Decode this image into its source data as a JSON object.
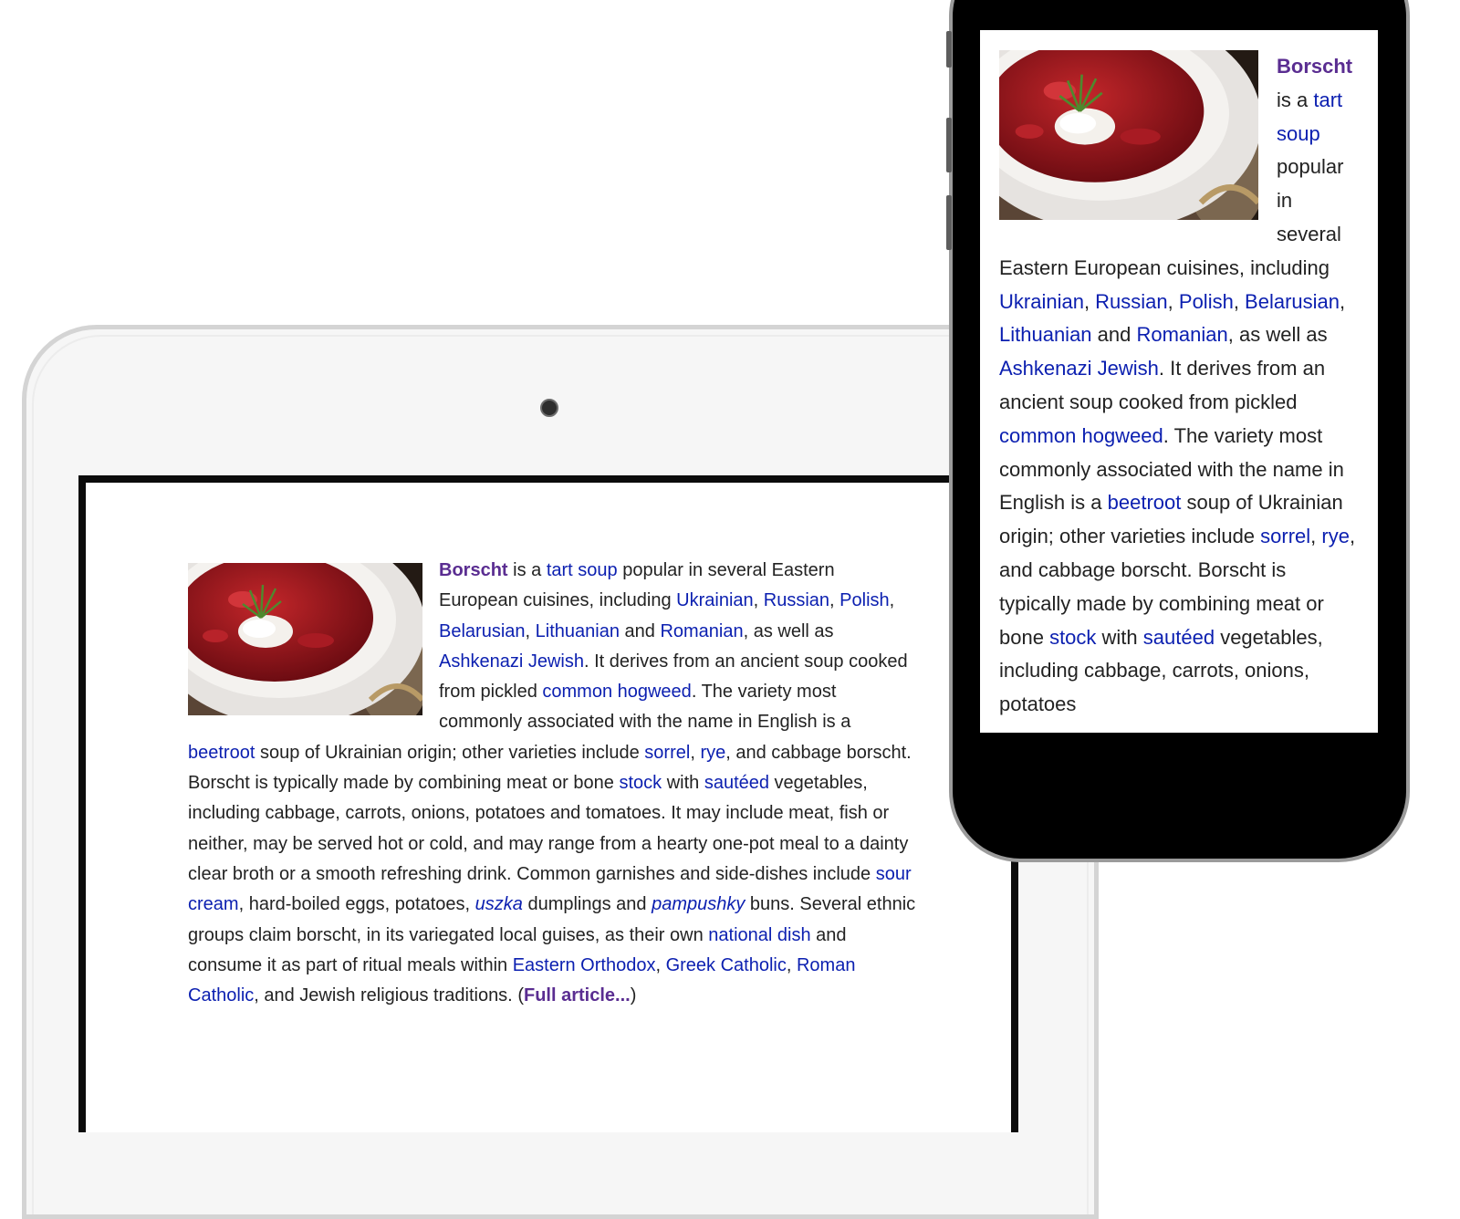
{
  "article": {
    "title": "Borscht",
    "full_article_link": "Full article...",
    "open_paren": "(",
    "close_paren": ")",
    "segments": {
      "s01": " is a ",
      "l01": "tart",
      "s02": " ",
      "l02": "soup",
      "s03": " popular in several Eastern European cuisines, including ",
      "l03": "Ukrainian",
      "s04": ", ",
      "l04": "Russian",
      "s05": ", ",
      "l05": "Polish",
      "s06": ", ",
      "l06": "Belarusian",
      "s07": ", ",
      "l07": "Lithuanian",
      "s08": " and ",
      "l08": "Romanian",
      "s09": ", as well as ",
      "l09": "Ashkenazi Jewish",
      "s10": ". It derives from an ancient soup cooked from pickled ",
      "l10": "common hogweed",
      "s11": ". The variety most commonly associated with the name in English is a ",
      "l11": "beetroot",
      "s12": " soup of Ukrainian origin; other varieties include ",
      "l12": "sorrel",
      "s13": ", ",
      "l13": "rye",
      "s14": ", and cabbage borscht. Borscht is typically made by combining meat or bone ",
      "l14": "stock",
      "s15": " with ",
      "l15": "sautéed",
      "s16": " vegetables, including cabbage, carrots, onions, potatoes and tomatoes. It may include meat, fish or neither, may be served hot or cold, and may range from a hearty one-pot meal to a dainty clear broth or a smooth refreshing drink. Common garnishes and side-dishes include ",
      "l16": "sour cream",
      "s17": ", hard-boiled eggs, potatoes, ",
      "l17": "uszka",
      "s18": " dumplings and ",
      "l18": "pampushky",
      "s19": " buns. Several ethnic groups claim borscht, in its variegated local guises, as their own ",
      "l19": "national dish",
      "s20": " and consume it as part of ritual meals within ",
      "l20": "Eastern Orthodox",
      "s21": ", ",
      "l21": "Greek Catholic",
      "s22": ", ",
      "l22": "Roman Catholic",
      "s23": ", and Jewish religious traditions. "
    },
    "phone_segments": {
      "s11": ". The variety most commonly associated with the name in English is a ",
      "s14": ", and cabbage borscht. Borscht is typically made by combining meat or bone ",
      "s16": " vegetables, including cabbage, carrots, onions, potatoes"
    },
    "image_icon": "borscht-soup-photo"
  },
  "colors": {
    "link": "#0b1fb0",
    "visited_bold": "#5a2d91",
    "text": "#222222",
    "tablet_bezel": "#f6f6f6",
    "phone_body": "#000000"
  }
}
